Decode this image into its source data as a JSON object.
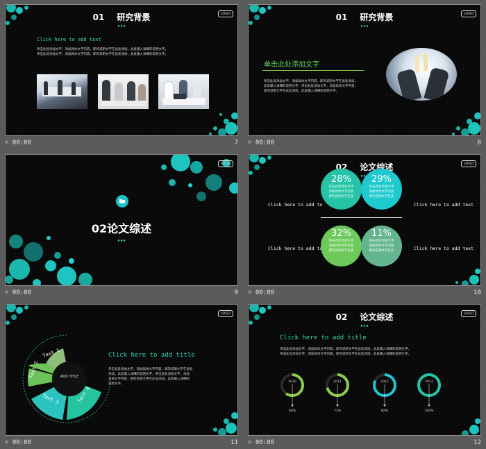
{
  "slides": [
    {
      "index": 7,
      "time": "00:00",
      "number": "7",
      "title_num": "01",
      "title": "研究背景",
      "logo": "LOGO",
      "subtitle": "Click here to add text",
      "body": [
        "单击此处添加文字，添加具体文字内容，即的说明文字在此处添加，此处输入详细的说明文字。",
        "单击此处添加文字，添加具体文字内容，即的说明文字在此处添加，此处输入详细的说明文字。"
      ],
      "photos": [
        "office-meeting-photo",
        "business-team-photo",
        "laptop-meeting-photo"
      ]
    },
    {
      "index": 8,
      "time": "00:00",
      "number": "8",
      "title_num": "01",
      "title": "研究背景",
      "logo": "LOGO",
      "subtitle": "单击此处添加文字",
      "body": [
        "单击此处添加文字，添加具体文字内容，即的说明文字在此处添加，",
        "此处输入详细的说明文字，单击此处添加文字，添加具体文字内容，",
        "即的说明文字在此处添加，此处输入详细的说明文字。"
      ],
      "photo": "champagne-toast-photo"
    },
    {
      "index": 9,
      "time": "00:00",
      "number": "9",
      "logo": "LOGO",
      "title_num": "02",
      "title": "论文综述",
      "icon": "folder-icon"
    },
    {
      "index": 10,
      "time": "00:00",
      "number": "10",
      "title_num": "02",
      "title": "论文综述",
      "logo": "LOGO",
      "labels": [
        "Click here to add to",
        "Click here to add text",
        "Click here to add to",
        "Click here to add text"
      ],
      "quads": [
        {
          "pct": "28%",
          "color": "#26c4a6",
          "text": [
            "单击此处添加文字",
            "添加具体文字内容",
            "即的说明文字在此"
          ]
        },
        {
          "pct": "29%",
          "color": "#1ec9cf",
          "text": [
            "单击此处添加文字",
            "添加具体文字内容",
            "即的说明文字在此"
          ]
        },
        {
          "pct": "32%",
          "color": "#6ec95b",
          "text": [
            "单击此处添加文字",
            "添加具体文字内容",
            "即的说明文字在此"
          ]
        },
        {
          "pct": "11%",
          "color": "#63b48f",
          "text": [
            "单击此处添加文字",
            "添加具体文字内容",
            "即的说明文字在此"
          ]
        }
      ]
    },
    {
      "index": 11,
      "time": "00:00",
      "number": "11",
      "logo": "LOGO",
      "title": "Click here to add title",
      "center": "ADD TITLE",
      "segments": [
        "Text 1",
        "Text 2",
        "Text 3",
        "Text 4"
      ],
      "body": [
        "单击此处添加文字，添加具体文字内容，即的说明文字在此处",
        "添加，此处输入详细的说明文字，单击此处添加文字，添加",
        "具体文字内容，即的说明文字在此处添加，此处输入详细的",
        "说明文字。"
      ]
    },
    {
      "index": 12,
      "time": "00:00",
      "number": "12",
      "title_num": "02",
      "title": "论文综述",
      "logo": "LOGO",
      "subtitle": "Click here to add title",
      "body": [
        "单击此处添加文字，添加具体文字内容，即的说明文字在此处添加，此处输入详细的说明文字。",
        "单击此处添加文字，添加具体文字内容，即的说明文字在此处添加，此处输入详细的说明文字。"
      ],
      "rings": [
        {
          "year": "2010",
          "pct": "60%",
          "color": "#8dcc4c",
          "value": 0.6
        },
        {
          "year": "2011",
          "pct": "71%",
          "color": "#8dcc4c",
          "value": 0.71
        },
        {
          "year": "2012",
          "pct": "82%",
          "color": "#21c4d3",
          "value": 0.82
        },
        {
          "year": "2013",
          "pct": "100%",
          "color": "#26c4a6",
          "value": 1.0
        }
      ]
    }
  ]
}
